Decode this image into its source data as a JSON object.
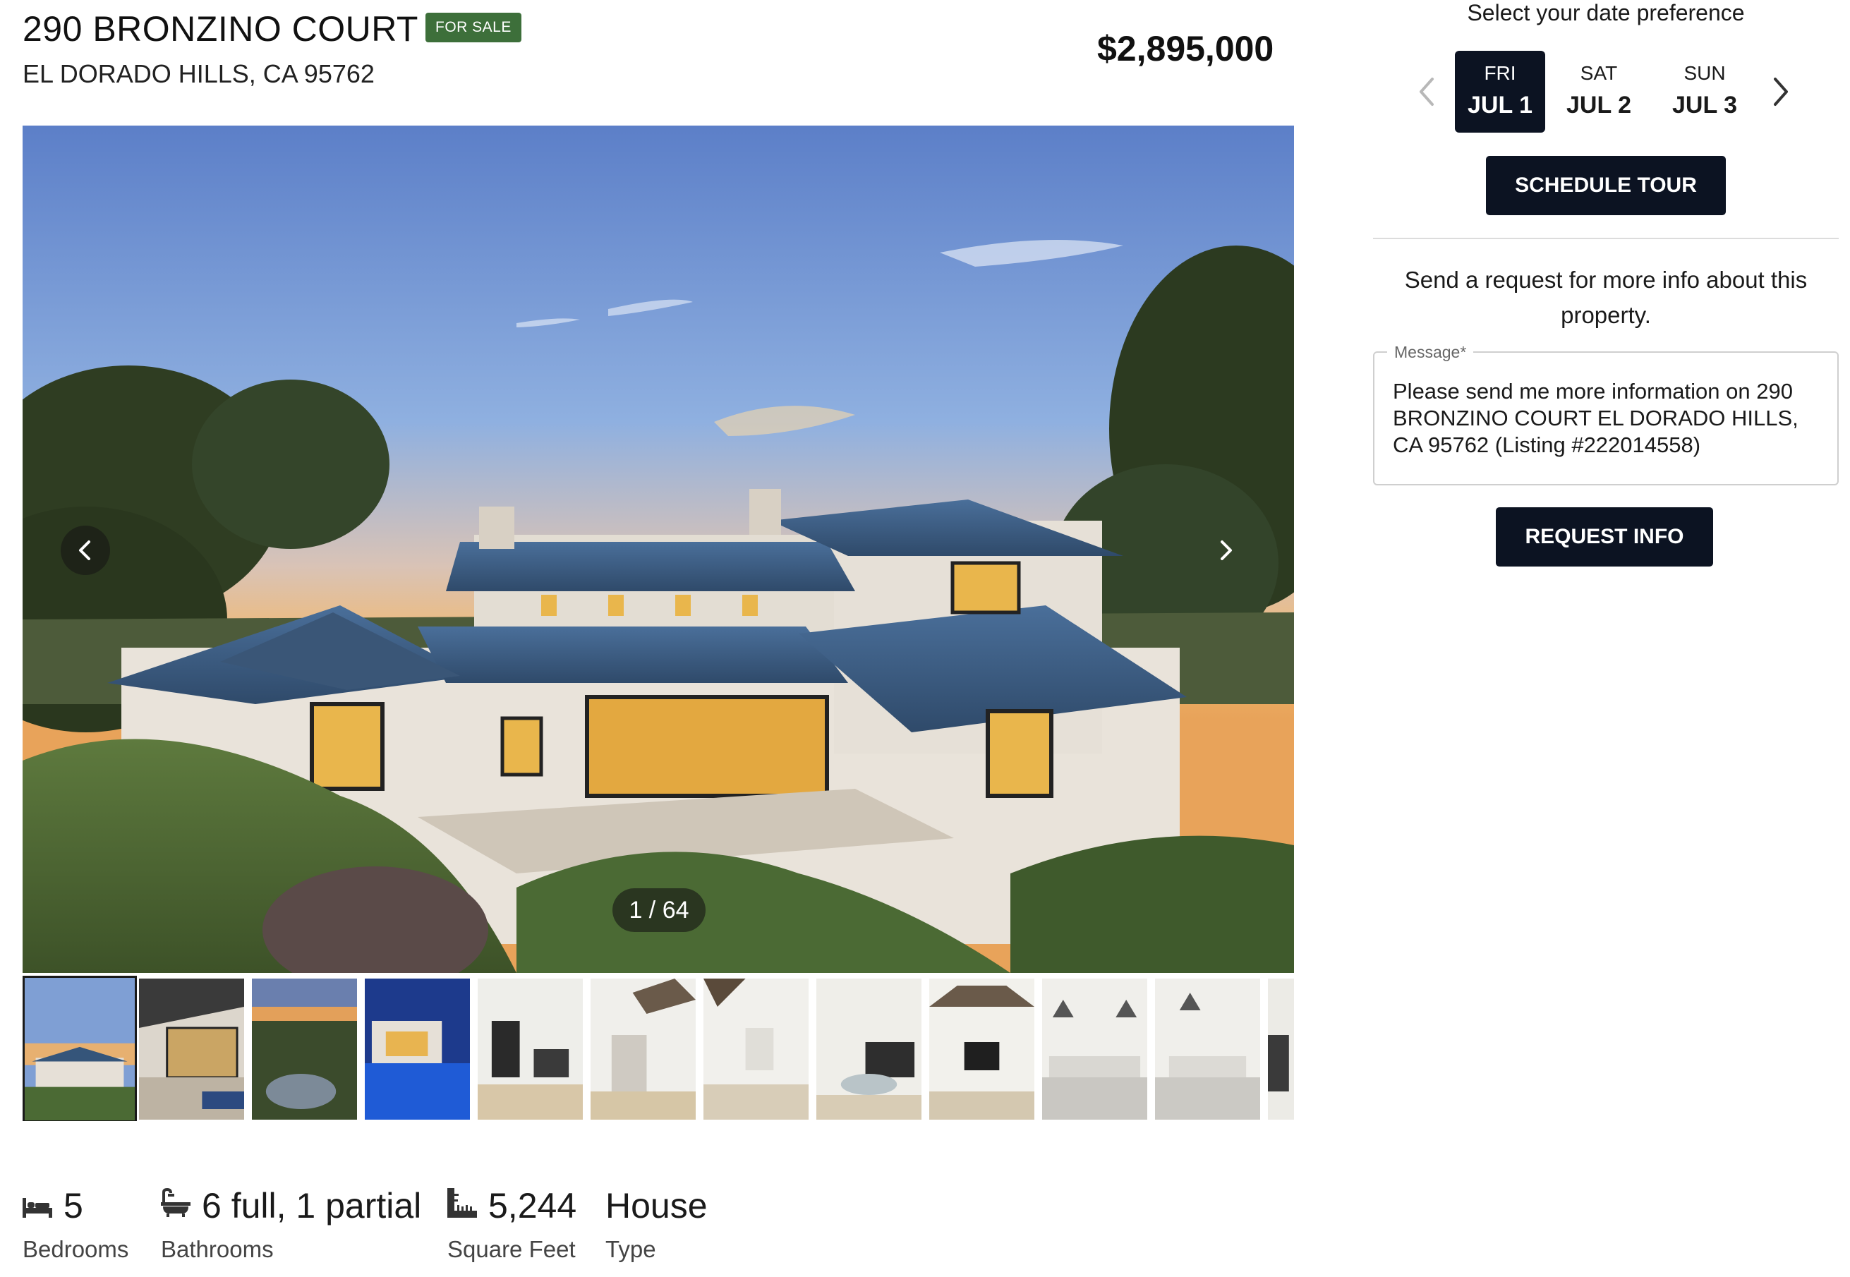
{
  "listing": {
    "address_line1": "290 BRONZINO COURT",
    "status_badge": "FOR SALE",
    "address_line2": "EL DORADO HILLS, CA 95762",
    "price": "$2,895,000"
  },
  "gallery": {
    "counter": "1 / 64",
    "thumbnail_count": 12
  },
  "facts": [
    {
      "value": "5",
      "label": "Bedrooms",
      "icon": "bed-icon"
    },
    {
      "value": "6 full, 1 partial",
      "label": "Bathrooms",
      "icon": "bathtub-icon"
    },
    {
      "value": "5,244",
      "label": "Square Feet",
      "icon": "ruler-icon"
    },
    {
      "value": "House",
      "label": "Type",
      "icon": ""
    }
  ],
  "tour": {
    "title": "Select your date preference",
    "days": [
      {
        "dow": "FRI",
        "date": "JUL 1",
        "selected": true
      },
      {
        "dow": "SAT",
        "date": "JUL 2",
        "selected": false
      },
      {
        "dow": "SUN",
        "date": "JUL 3",
        "selected": false
      }
    ],
    "schedule_label": "SCHEDULE TOUR"
  },
  "request": {
    "intro": "Send a request for more info about this property.",
    "message_label": "Message*",
    "message_value": "Please send me more information on 290 BRONZINO COURT EL DORADO HILLS, CA 95762 (Listing #222014558)",
    "button_label": "REQUEST INFO"
  },
  "colors": {
    "badge": "#3d6f3a",
    "button_dark": "#0c1322"
  }
}
